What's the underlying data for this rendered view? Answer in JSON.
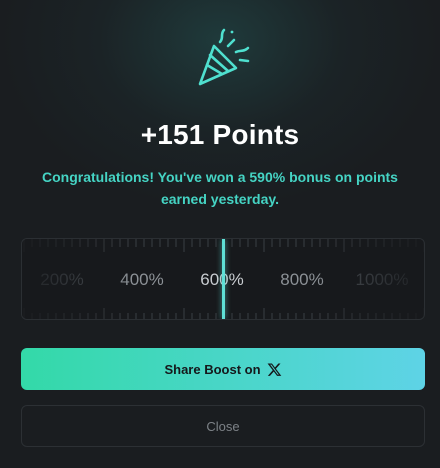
{
  "reward": {
    "title": "+151 Points",
    "message": "Congratulations! You've won a 590% bonus on points earned yesterday."
  },
  "ruler": {
    "labels": [
      "200%",
      "400%",
      "600%",
      "800%",
      "1000%"
    ],
    "selected_value": "590%",
    "indicator_color": "#5fe0d6"
  },
  "actions": {
    "share_label": "Share Boost on",
    "share_icon": "x-logo-icon",
    "close_label": "Close"
  },
  "colors": {
    "accent": "#45d4c4",
    "button_gradient_start": "#33d9a8",
    "button_gradient_end": "#5ed3e6"
  },
  "icons": {
    "header": "party-popper-icon"
  }
}
